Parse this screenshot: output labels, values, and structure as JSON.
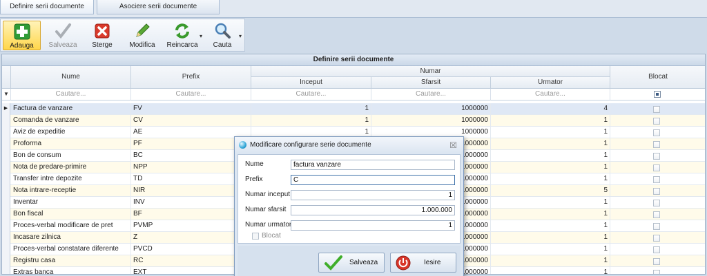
{
  "tabs": [
    {
      "label": "Definire serii documente"
    },
    {
      "label": "Asociere serii documente"
    }
  ],
  "toolbar": {
    "add": "Adauga",
    "save": "Salveaza",
    "delete": "Sterge",
    "edit": "Modifica",
    "reload": "Reincarca",
    "search": "Cauta"
  },
  "grid": {
    "title": "Definire serii documente",
    "headers": {
      "nume": "Nume",
      "prefix": "Prefix",
      "numar": "Numar",
      "inceput": "Inceput",
      "sfarsit": "Sfarsit",
      "urmator": "Urmator",
      "blocat": "Blocat"
    },
    "filter_placeholder": "Cautare...",
    "rows": [
      {
        "nume": "Factura de vanzare",
        "prefix": "FV",
        "inceput": "1",
        "sfarsit": "1000000",
        "urmator": "4"
      },
      {
        "nume": "Comanda de vanzare",
        "prefix": "CV",
        "inceput": "1",
        "sfarsit": "1000000",
        "urmator": "1"
      },
      {
        "nume": "Aviz de expeditie",
        "prefix": "AE",
        "inceput": "1",
        "sfarsit": "1000000",
        "urmator": "1"
      },
      {
        "nume": "Proforma",
        "prefix": "PF",
        "inceput": "",
        "sfarsit": "1000000",
        "urmator": "1"
      },
      {
        "nume": "Bon de consum",
        "prefix": "BC",
        "inceput": "",
        "sfarsit": "1000000",
        "urmator": "1"
      },
      {
        "nume": "Nota de predare-primire",
        "prefix": "NPP",
        "inceput": "",
        "sfarsit": "1000000",
        "urmator": "1"
      },
      {
        "nume": "Transfer intre depozite",
        "prefix": "TD",
        "inceput": "",
        "sfarsit": "1000000",
        "urmator": "1"
      },
      {
        "nume": "Nota intrare-receptie",
        "prefix": "NIR",
        "inceput": "",
        "sfarsit": "1000000",
        "urmator": "5"
      },
      {
        "nume": "Inventar",
        "prefix": "INV",
        "inceput": "",
        "sfarsit": "1000000",
        "urmator": "1"
      },
      {
        "nume": "Bon fiscal",
        "prefix": "BF",
        "inceput": "",
        "sfarsit": "1000000",
        "urmator": "1"
      },
      {
        "nume": "Proces-verbal modificare de pret",
        "prefix": "PVMP",
        "inceput": "",
        "sfarsit": "1000000",
        "urmator": "1"
      },
      {
        "nume": "Incasare zilnica",
        "prefix": "Z",
        "inceput": "",
        "sfarsit": "1000000",
        "urmator": "1"
      },
      {
        "nume": "Proces-verbal constatare diferente",
        "prefix": "PVCD",
        "inceput": "",
        "sfarsit": "1000000",
        "urmator": "1"
      },
      {
        "nume": "Registru casa",
        "prefix": "RC",
        "inceput": "",
        "sfarsit": "1000000",
        "urmator": "1"
      },
      {
        "nume": "Extras banca",
        "prefix": "EXT",
        "inceput": "",
        "sfarsit": "1000000",
        "urmator": "1"
      }
    ]
  },
  "dialog": {
    "title": "Modificare configurare serie documente",
    "labels": {
      "nume": "Nume",
      "prefix": "Prefix",
      "inceput": "Numar inceput",
      "sfarsit": "Numar sfarsit",
      "urmator": "Numar urmator",
      "blocat": "Blocat"
    },
    "values": {
      "nume": "factura vanzare",
      "prefix": "C",
      "inceput": "1",
      "sfarsit": "1.000.000",
      "urmator": "1"
    },
    "save": "Salveaza",
    "exit": "Iesire"
  }
}
